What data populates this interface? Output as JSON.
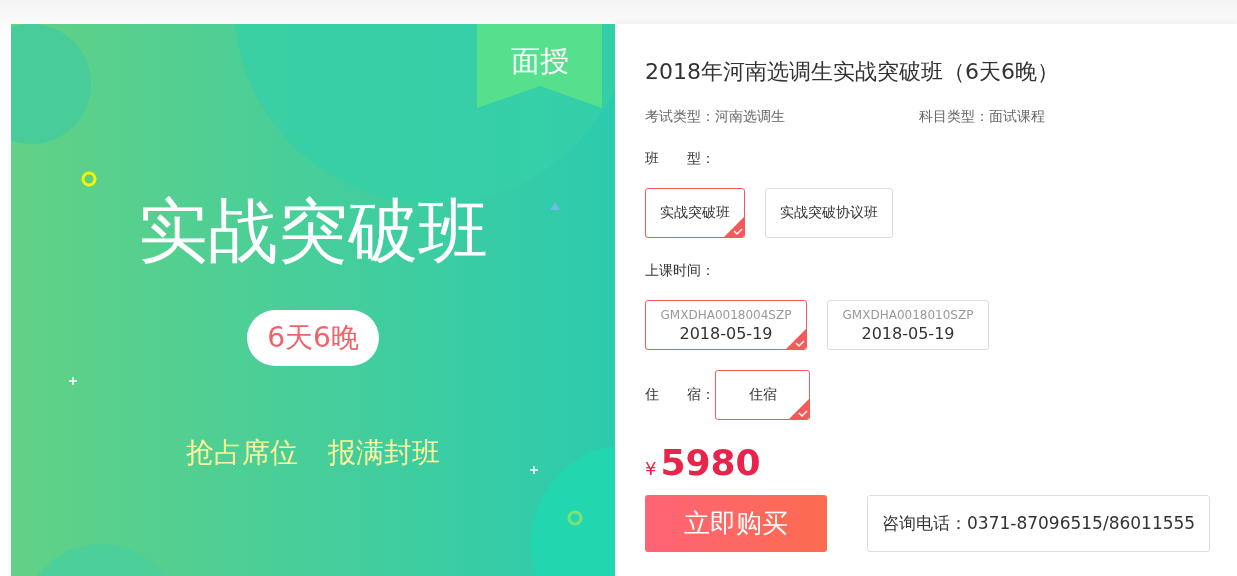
{
  "banner": {
    "ribbon": "面授",
    "title": "实战突破班",
    "badge": "6天6晚",
    "slogans": [
      "抢占席位",
      "报满封班"
    ]
  },
  "product": {
    "title": "2018年河南选调生实战突破班（6天6晚）",
    "meta": [
      {
        "label": "考试类型：",
        "value": "河南选调生"
      },
      {
        "label": "科目类型：",
        "value": "面试课程"
      }
    ],
    "class_type": {
      "label": "班　　型：",
      "options": [
        {
          "label": "实战突破班",
          "selected": true
        },
        {
          "label": "实战突破协议班",
          "selected": false
        }
      ]
    },
    "schedule": {
      "label": "上课时间：",
      "options": [
        {
          "code": "GMXDHA0018004SZP",
          "date": "2018-05-19",
          "selected": true
        },
        {
          "code": "GMXDHA0018010SZP",
          "date": "2018-05-19",
          "selected": false
        }
      ]
    },
    "lodging": {
      "label": "住　　宿：",
      "options": [
        {
          "label": "住宿",
          "selected": true
        }
      ]
    },
    "price": {
      "currency": "¥",
      "amount": "5980"
    },
    "buy_button": "立即购买",
    "hotline": "咨询电话：0371-87096515/86011555"
  }
}
